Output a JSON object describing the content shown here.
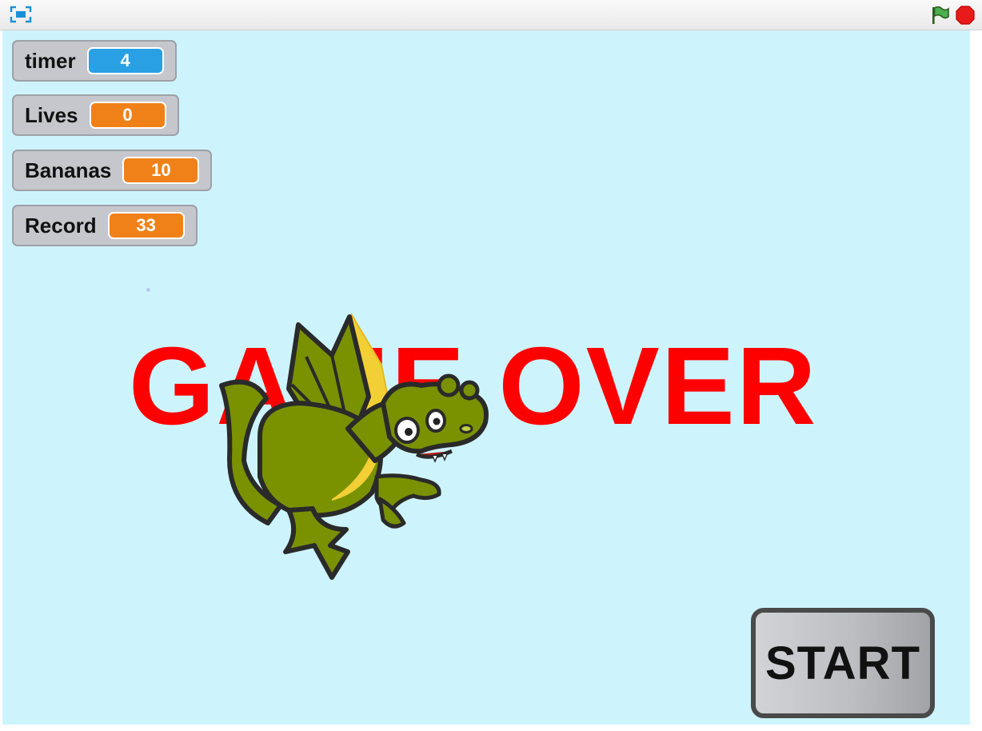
{
  "toolbar": {
    "fullscreen_icon": "fullscreen-icon",
    "flag_icon": "green-flag-icon",
    "stop_icon": "stop-icon"
  },
  "monitors": [
    {
      "label": "timer",
      "value": "4",
      "color": "#29a0e4"
    },
    {
      "label": "Lives",
      "value": "0",
      "color": "#f08119"
    },
    {
      "label": "Bananas",
      "value": "10",
      "color": "#f08119"
    },
    {
      "label": "Record",
      "value": "33",
      "color": "#f08119"
    }
  ],
  "stage": {
    "background": "#cdf4fd",
    "game_over_text": "GAME OVER",
    "game_over_color": "#ff0000",
    "sprite": "dragon-sprite",
    "start_button_label": "START"
  }
}
